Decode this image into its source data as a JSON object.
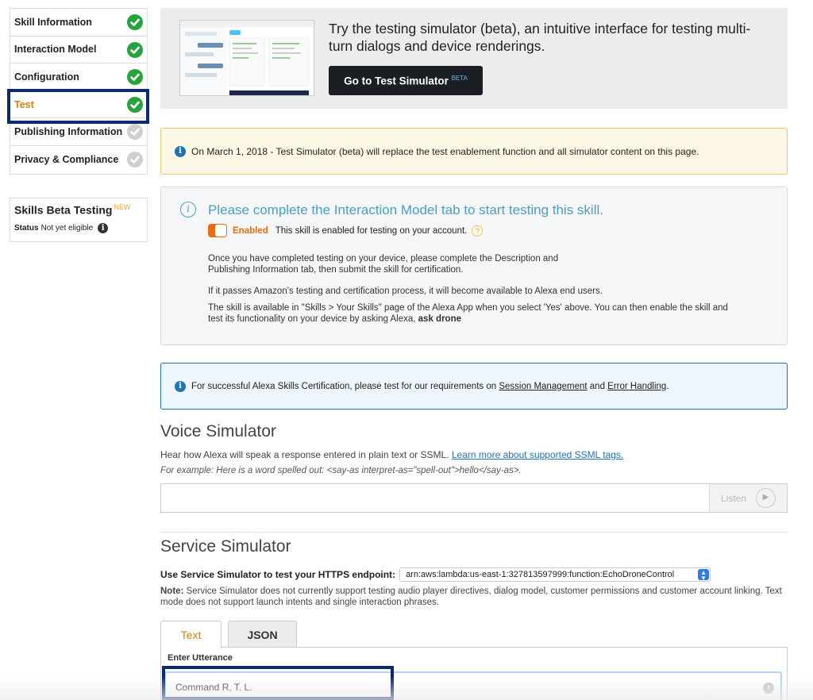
{
  "sidebar": {
    "items": [
      {
        "label": "Skill Information",
        "status": "complete"
      },
      {
        "label": "Interaction Model",
        "status": "complete"
      },
      {
        "label": "Configuration",
        "status": "complete"
      },
      {
        "label": "Test",
        "status": "complete",
        "active": true
      },
      {
        "label": "Publishing Information",
        "status": "incomplete"
      },
      {
        "label": "Privacy & Compliance",
        "status": "incomplete"
      }
    ],
    "beta": {
      "title": "Skills Beta Testing",
      "badge": "NEW",
      "status_label": "Status",
      "status_value": "Not yet eligible"
    }
  },
  "promo": {
    "text": "Try the testing simulator (beta), an intuitive interface for testing multi-turn dialogs and device renderings.",
    "button_label": "Go to Test Simulator",
    "button_badge": "BETA"
  },
  "warning": {
    "text": "On March 1, 2018 - Test Simulator (beta) will replace the test enablement function and all simulator content on this page."
  },
  "test_panel": {
    "heading": "Please complete the Interaction Model tab to start testing this skill.",
    "toggle_label": "Enabled",
    "toggle_desc": "This skill is enabled for testing on your account.",
    "para1": "Once you have completed testing on your device, please complete the Description and Publishing Information tab, then submit the skill for certification.",
    "para2": "If it passes Amazon's testing and certification process, it will become available to Alexa end users.",
    "para3": "The skill is available in \"Skills > Your Skills\" page of the Alexa App when you select 'Yes' above. You can then enable the skill and test its functionality on your device by asking Alexa,",
    "para3_bold": "ask drone"
  },
  "cert_info": {
    "text_before": "For successful Alexa Skills Certification, please test for our requirements on",
    "link1": "Session Management",
    "text_mid": "and",
    "link2": "Error Handling",
    "text_after": "."
  },
  "voice_simulator": {
    "title": "Voice Simulator",
    "description": "Hear how Alexa will speak a response entered in plain text or SSML.",
    "link": "Learn more about supported SSML tags.",
    "example": "For example: Here is a word spelled out: <say-as interpret-as=\"spell-out\">hello</say-as>.",
    "input_value": "",
    "listen_label": "Listen"
  },
  "service_simulator": {
    "title": "Service Simulator",
    "endpoint_label": "Use Service Simulator to test your HTTPS endpoint:",
    "endpoint_value": "arn:aws:lambda:us-east-1:327813597999:function:EchoDroneControl",
    "note_label": "Note:",
    "note_text": "Service Simulator does not currently support testing audio player directives, dialog model, customer permissions and customer account linking. Text mode does not support launch intents and single interaction phrases.",
    "tabs": [
      "Text",
      "JSON"
    ],
    "active_tab": "Text",
    "utterance_label": "Enter Utterance",
    "utterance_value": "Command R, T. L."
  },
  "colors": {
    "complete": "#27a33d",
    "incomplete": "#cfcfcf",
    "active_nav": "#d27f13",
    "toggle_on": "#e96c12",
    "info_blue": "#2173b6",
    "highlight": "#0d2a6e"
  },
  "icons": [
    "check-circle-icon",
    "info-icon",
    "help-icon",
    "play-icon",
    "clear-icon",
    "select-arrows-icon"
  ]
}
